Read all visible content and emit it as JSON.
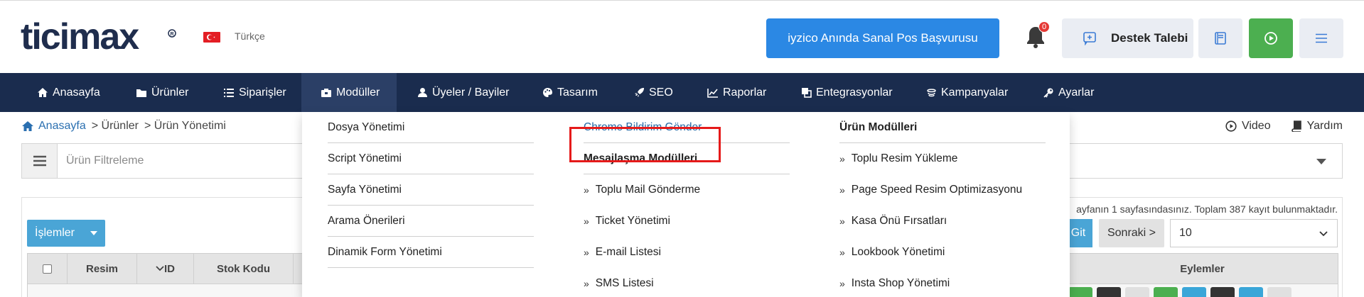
{
  "header": {
    "brand": "ticimax",
    "language": "Türkçe",
    "iyzico_button": "iyzico Anında Sanal Pos Başvurusu",
    "notification_count": "0",
    "support_button": "Destek Talebi",
    "colors": {
      "primary_blue": "#2b88e4",
      "green": "#4caf50",
      "navy": "#1a2c4e",
      "highlight_red": "#e51a1a"
    }
  },
  "nav": {
    "items": [
      {
        "label": "Anasayfa",
        "icon": "home-icon"
      },
      {
        "label": "Ürünler",
        "icon": "folder-icon"
      },
      {
        "label": "Siparişler",
        "icon": "list-icon"
      },
      {
        "label": "Modüller",
        "icon": "box-icon",
        "active": true
      },
      {
        "label": "Üyeler / Bayiler",
        "icon": "user-icon"
      },
      {
        "label": "Tasarım",
        "icon": "palette-icon"
      },
      {
        "label": "SEO",
        "icon": "rocket-icon"
      },
      {
        "label": "Raporlar",
        "icon": "chart-icon"
      },
      {
        "label": "Entegrasyonlar",
        "icon": "clone-icon"
      },
      {
        "label": "Kampanyalar",
        "icon": "campaign-icon"
      },
      {
        "label": "Ayarlar",
        "icon": "key-icon"
      }
    ]
  },
  "breadcrumb": {
    "home": "Anasayfa",
    "level1": "> Ürünler",
    "level2": "> Ürün Yönetimi"
  },
  "right_links": {
    "video": "Video",
    "help": "Yardım"
  },
  "filter": {
    "label": "Ürün Filtreleme"
  },
  "panel": {
    "actions_button": "İşlemler",
    "page_info": "ayfanın 1 sayfasındasınız. Toplam 387 kayıt bulunmaktadır.",
    "go_button": "Git",
    "next_button": "Sonraki >",
    "page_size": "10",
    "columns": {
      "image": "Resim",
      "id": "ID",
      "stock_code": "Stok Kodu",
      "actions": "Eylemler"
    }
  },
  "mega_menu": {
    "col1": [
      "Dosya Yönetimi",
      "Script Yönetimi",
      "Sayfa Yönetimi",
      "Arama Önerileri",
      "Dinamik Form Yönetimi"
    ],
    "col2": {
      "highlighted": "Chrome Bildirim Gönder",
      "heading": "Mesajlaşma Modülleri",
      "items": [
        "Toplu Mail Gönderme",
        "Ticket Yönetimi",
        "E-mail Listesi",
        "SMS Listesi"
      ]
    },
    "col3": {
      "heading": "Ürün Modülleri",
      "items": [
        "Toplu Resim Yükleme",
        "Page Speed Resim Optimizasyonu",
        "Kasa Önü Fırsatları",
        "Lookbook Yönetimi",
        "Insta Shop Yönetimi"
      ]
    }
  }
}
